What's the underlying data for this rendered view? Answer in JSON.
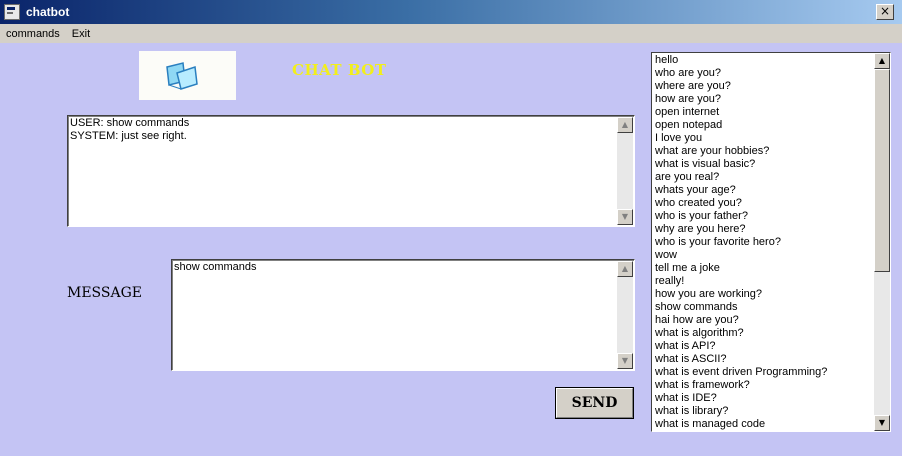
{
  "window": {
    "title": "chatbot",
    "close_label": "×"
  },
  "menu": {
    "items": [
      "commands",
      "Exit"
    ]
  },
  "header": {
    "title": "CHAT BOT"
  },
  "chat_log": {
    "lines": [
      "USER: show commands",
      "SYSTEM: just see right."
    ]
  },
  "message": {
    "label": "MESSAGE",
    "value": "show commands"
  },
  "send": {
    "label": "SEND"
  },
  "commands_list": {
    "items": [
      "hello",
      "who are you?",
      "where are you?",
      "how are you?",
      "open internet",
      "open notepad",
      "I love you",
      "what are your hobbies?",
      "what is visual basic?",
      "are you real?",
      "whats your age?",
      "who created you?",
      "who is your father?",
      "why are you here?",
      "who is your favorite hero?",
      "wow",
      "tell me a joke",
      "really!",
      "how you are working?",
      "show commands",
      "hai how are you?",
      "what is algorithm?",
      "what is API?",
      "what is ASCII?",
      "what is event driven Programming?",
      "what is framework?",
      "what is IDE?",
      "what is library?",
      "what is managed code"
    ]
  },
  "colors": {
    "background": "#c4c4f4",
    "title_text": "#f2ef1a",
    "titlebar_start": "#0a246a",
    "titlebar_end": "#a6caf0"
  },
  "icons": {
    "app": "app-window-icon",
    "logo": "chat-logo-icon",
    "scroll_up": "arrow-up-icon",
    "scroll_down": "arrow-down-icon"
  }
}
